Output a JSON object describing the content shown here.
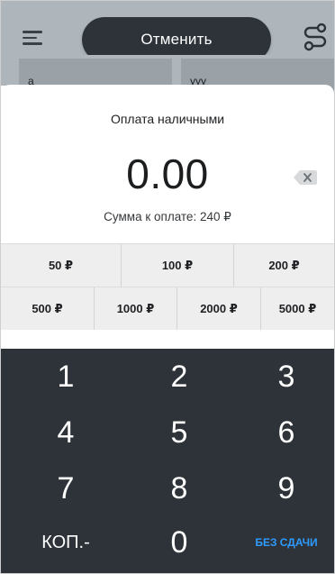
{
  "header": {
    "cancel_label": "Отменить",
    "menu_icon": "hamburger-menu-icon",
    "route_icon": "route-icon"
  },
  "background_tiles": [
    {
      "label": "a"
    },
    {
      "label": "yyy"
    }
  ],
  "payment": {
    "title": "Оплата наличными",
    "amount": "0.00",
    "amount_due": "Сумма к оплате: 240 ₽",
    "backspace_icon": "backspace-icon"
  },
  "quick_amounts": {
    "row1": [
      "50 ₽",
      "100 ₽",
      "200 ₽"
    ],
    "row2": [
      "500 ₽",
      "1000 ₽",
      "2000 ₽",
      "5000 ₽"
    ]
  },
  "keypad": {
    "keys": [
      "1",
      "2",
      "3",
      "4",
      "5",
      "6",
      "7",
      "8",
      "9"
    ],
    "kopecks_label": "КОП.-",
    "zero": "0",
    "no_change_label": "БЕЗ СДАЧИ"
  },
  "colors": {
    "dark": "#2d3338",
    "accent": "#2f9bff",
    "quick_bg": "#eeeeee",
    "backdrop": "#aeb6bb"
  }
}
